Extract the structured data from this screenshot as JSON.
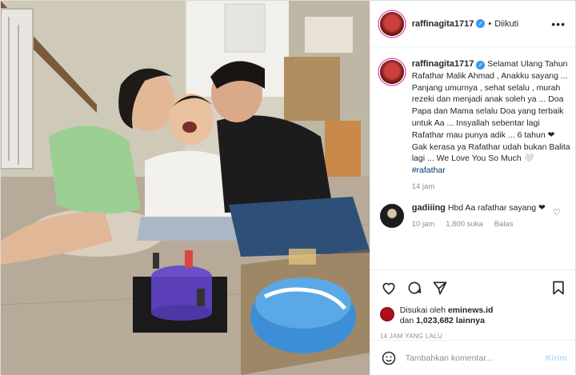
{
  "post": {
    "author": "raffinagita1717",
    "follow_status": "Diikuti",
    "caption": "Selamat Ulang Tahun Rafathar Malik Ahmad , Anakku sayang ... Panjang umurnya , sehat selalu , murah rezeki dan menjadi anak soleh ya ... Doa Papa dan Mama selalu Doa yang terbaik untuk Aa ... Insyallah sebentar lagi Rafathar mau punya adik ... 6 tahun ❤ Gak kerasa ya Rafathar udah bukan Balita lagi ... We Love You So Much 🤍",
    "hashtag": "#rafathar",
    "caption_time": "14 jam"
  },
  "comments": [
    {
      "user": "gadiiing",
      "text": "Hbd Aa rafathar sayang ❤",
      "time": "10 jam",
      "likes": "1,800 suka",
      "reply": "Balas"
    }
  ],
  "likes": {
    "prefix": "Disukai oleh",
    "user": "eminews.id",
    "connector": "dan",
    "count": "1,023,682 lainnya"
  },
  "timestamp": "14 JAM YANG LALU",
  "comment_box": {
    "placeholder": "Tambahkan komentar...",
    "send": "Kirim"
  },
  "icons": {
    "more": "more-icon",
    "verified": "verified-icon",
    "like": "heart-icon",
    "comment": "comment-icon",
    "share": "share-icon",
    "save": "bookmark-icon",
    "emoji": "emoji-icon"
  },
  "colors": {
    "verified": "#3897f0",
    "hashtag": "#00376b",
    "muted": "#8e8e8e",
    "send_disabled": "#b2dffc"
  }
}
